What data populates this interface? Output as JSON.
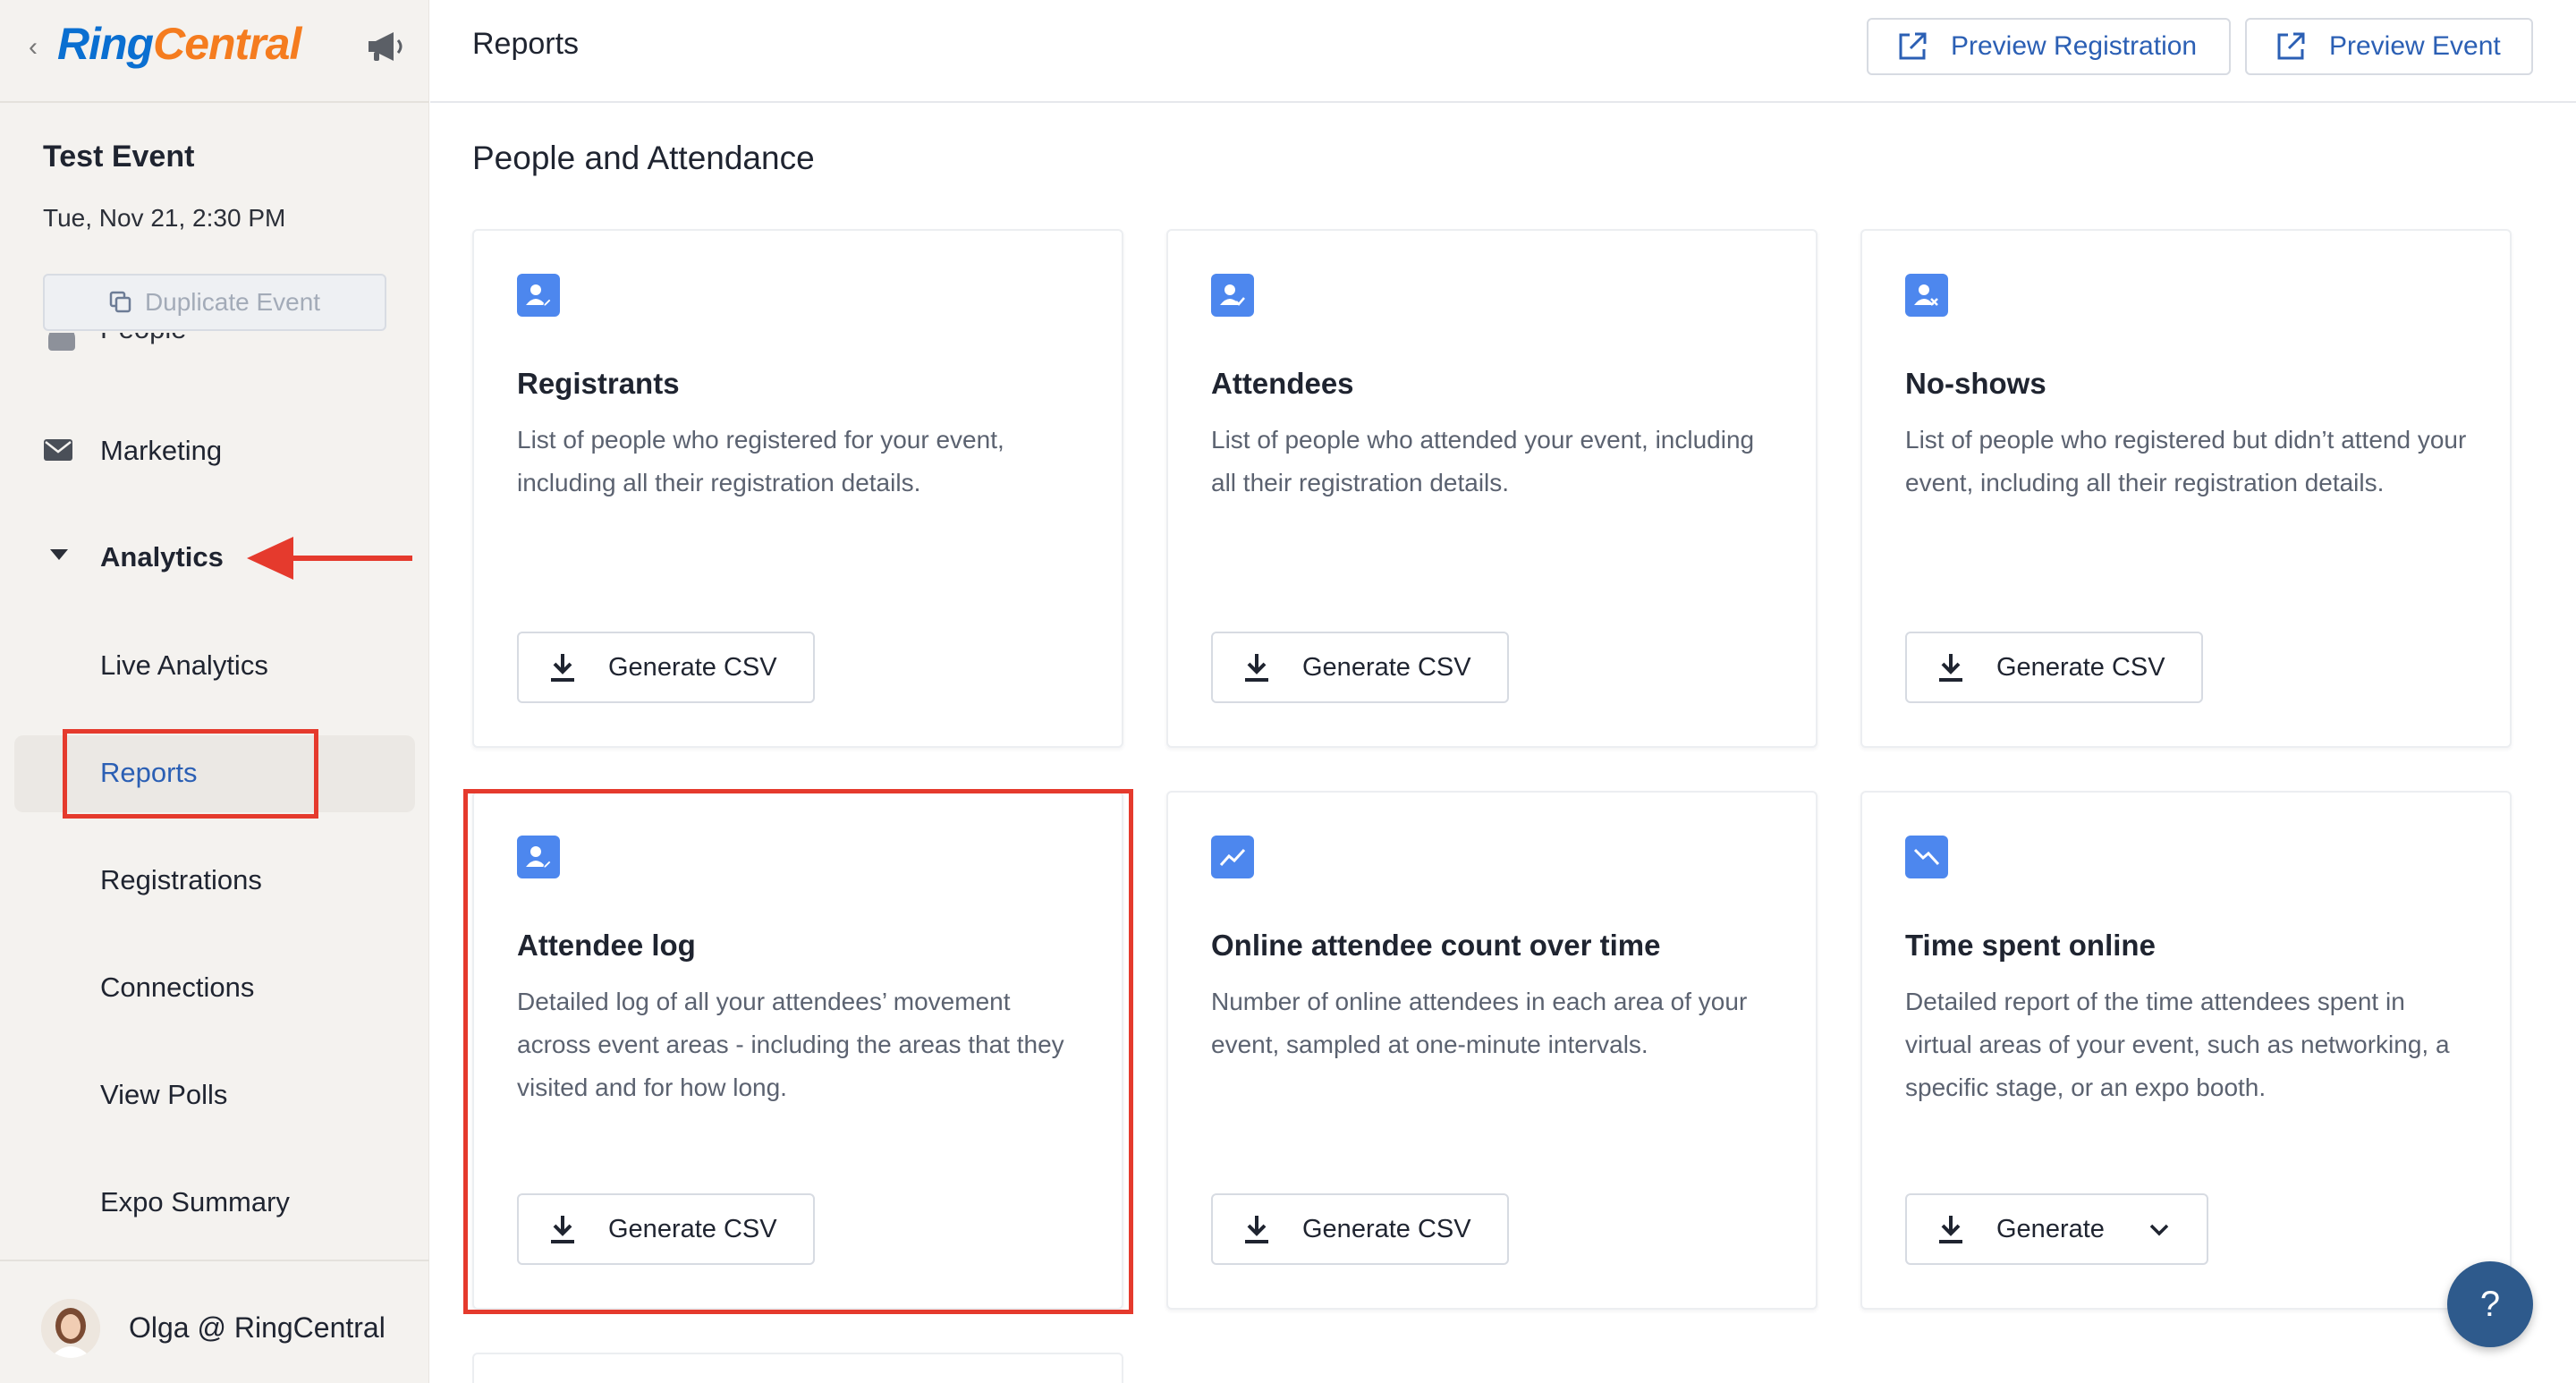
{
  "brand": {
    "logo_part1": "Ring",
    "logo_part2": "Central",
    "ring_color": "#0a6fd1",
    "central_color": "#f57c1f"
  },
  "sidebar": {
    "back_icon": "chevron-left-icon",
    "announce_icon": "megaphone-icon",
    "event_title": "Test Event",
    "event_date": "Tue, Nov 21, 2:30 PM",
    "duplicate_label": "Duplicate Event",
    "people_label": "People",
    "marketing_label": "Marketing",
    "analytics_label": "Analytics",
    "sub_items": [
      "Live Analytics",
      "Reports",
      "Registrations",
      "Connections",
      "View Polls",
      "Expo Summary"
    ],
    "active_item": "Reports",
    "user_name": "Olga @ RingCentral"
  },
  "header": {
    "title": "Reports",
    "preview_registration": "Preview Registration",
    "preview_event": "Preview Event",
    "accent_color": "#2b5fb4"
  },
  "main": {
    "section_title": "People and Attendance",
    "cards": [
      {
        "title": "Registrants",
        "description": "List of people who registered for your event, including all their registration details.",
        "button": "Generate CSV",
        "icon": "user-edit-icon"
      },
      {
        "title": "Attendees",
        "description": "List of people who attended your event, including all their registration details.",
        "button": "Generate CSV",
        "icon": "user-check-icon"
      },
      {
        "title": "No-shows",
        "description": "List of people who registered but didn’t attend your event, including all their registration details.",
        "button": "Generate CSV",
        "icon": "user-x-icon"
      },
      {
        "title": "Attendee log",
        "description": "Detailed log of all your attendees’ movement across event areas - including the areas that they visited and for how long.",
        "button": "Generate CSV",
        "icon": "user-edit-icon"
      },
      {
        "title": "Online attendee count over time",
        "description": "Number of online attendees in each area of your event, sampled at one-minute intervals.",
        "button": "Generate CSV",
        "icon": "trend-up-icon"
      },
      {
        "title": "Time spent online",
        "description": "Detailed report of the time attendees spent in virtual areas of your event, such as networking, a specific stage, or an expo booth.",
        "button": "Generate",
        "icon": "trend-down-icon"
      }
    ]
  },
  "help": {
    "label": "?"
  },
  "annotations": {
    "highlight_color": "#e53a2d"
  }
}
